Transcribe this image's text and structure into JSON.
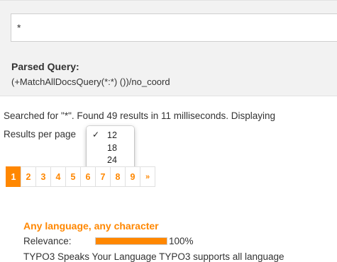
{
  "search": {
    "value": "*"
  },
  "parsed_query": {
    "label": "Parsed Query:",
    "value": "(+MatchAllDocsQuery(*:*) ())/no_coord"
  },
  "status": {
    "text": "Searched for \"*\". Found 49 results in 11 milliseconds. Displaying"
  },
  "results_per_page": {
    "label": "Results per page",
    "selected": "12",
    "options": [
      "12",
      "18",
      "24"
    ],
    "check_glyph": "✓"
  },
  "pagination": {
    "pages": [
      "1",
      "2",
      "3",
      "4",
      "5",
      "6",
      "7",
      "8",
      "9"
    ],
    "active": "1",
    "next": "»"
  },
  "result": {
    "title": "Any language, any character",
    "relevance_label": "Relevance:",
    "relevance_fraction": 1.0,
    "relevance_text": "100%",
    "snippet": "TYPO3 Speaks Your Language TYPO3 supports all language"
  },
  "colors": {
    "accent": "#ff8700",
    "panel_bg": "#f2f2f2",
    "text": "#333333"
  }
}
